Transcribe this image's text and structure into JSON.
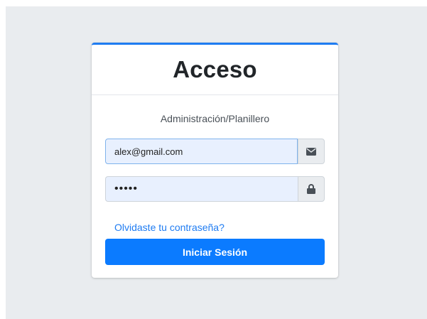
{
  "login": {
    "title": "Acceso",
    "subtitle": "Administración/Planillero",
    "email": {
      "value": "alex@gmail.com",
      "placeholder": "",
      "icon": "envelope-icon"
    },
    "password": {
      "value": "•••••",
      "placeholder": "",
      "icon": "lock-icon"
    },
    "forgot_label": "Olvidaste tu contraseña?",
    "submit_label": "Iniciar Sesión"
  },
  "colors": {
    "accent": "#1f7cf2",
    "button": "#0b7bff",
    "background": "#e9ecef",
    "input_fill": "#e8f0fe"
  }
}
